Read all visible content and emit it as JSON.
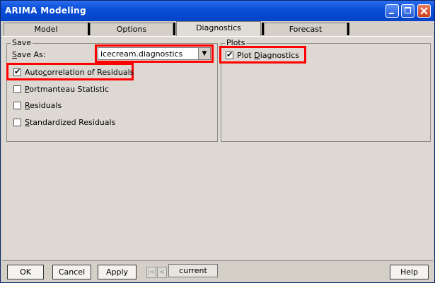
{
  "window": {
    "title": "ARIMA Modeling"
  },
  "tabs": [
    {
      "label": "Model"
    },
    {
      "label": "Options"
    },
    {
      "label": "Diagnostics",
      "active": true
    },
    {
      "label": "Forecast"
    }
  ],
  "save_group": {
    "title": "Save",
    "save_as": {
      "label_u": "S",
      "label_rest": "ave As:"
    },
    "dropdown_value": "icecream.diagnostics",
    "checkboxes": [
      {
        "u": "",
        "pre": "Auto",
        "u2": "c",
        "rest": "orrelation of Residuals",
        "checked": true
      },
      {
        "pre": "",
        "u2": "P",
        "rest": "ortmanteau Statistic",
        "checked": false
      },
      {
        "pre": "",
        "u2": "R",
        "rest": "esiduals",
        "checked": false
      },
      {
        "pre": "",
        "u2": "S",
        "rest": "tandardized Residuals",
        "checked": false
      }
    ]
  },
  "plots_group": {
    "title": "Plots",
    "plot_diagnostics": {
      "pre": "Plot ",
      "u2": "D",
      "rest": "iagnostics",
      "checked": true
    }
  },
  "bottom": {
    "ok": "OK",
    "cancel": "Cancel",
    "apply": "Apply",
    "current": "current",
    "help": "Help"
  },
  "icons": {
    "first": "first-icon",
    "prev": "prev-icon",
    "dropdown": "chevron-down-icon"
  },
  "colors": {
    "highlight": "#ff0000",
    "titlebar": "#0a4fd8"
  }
}
